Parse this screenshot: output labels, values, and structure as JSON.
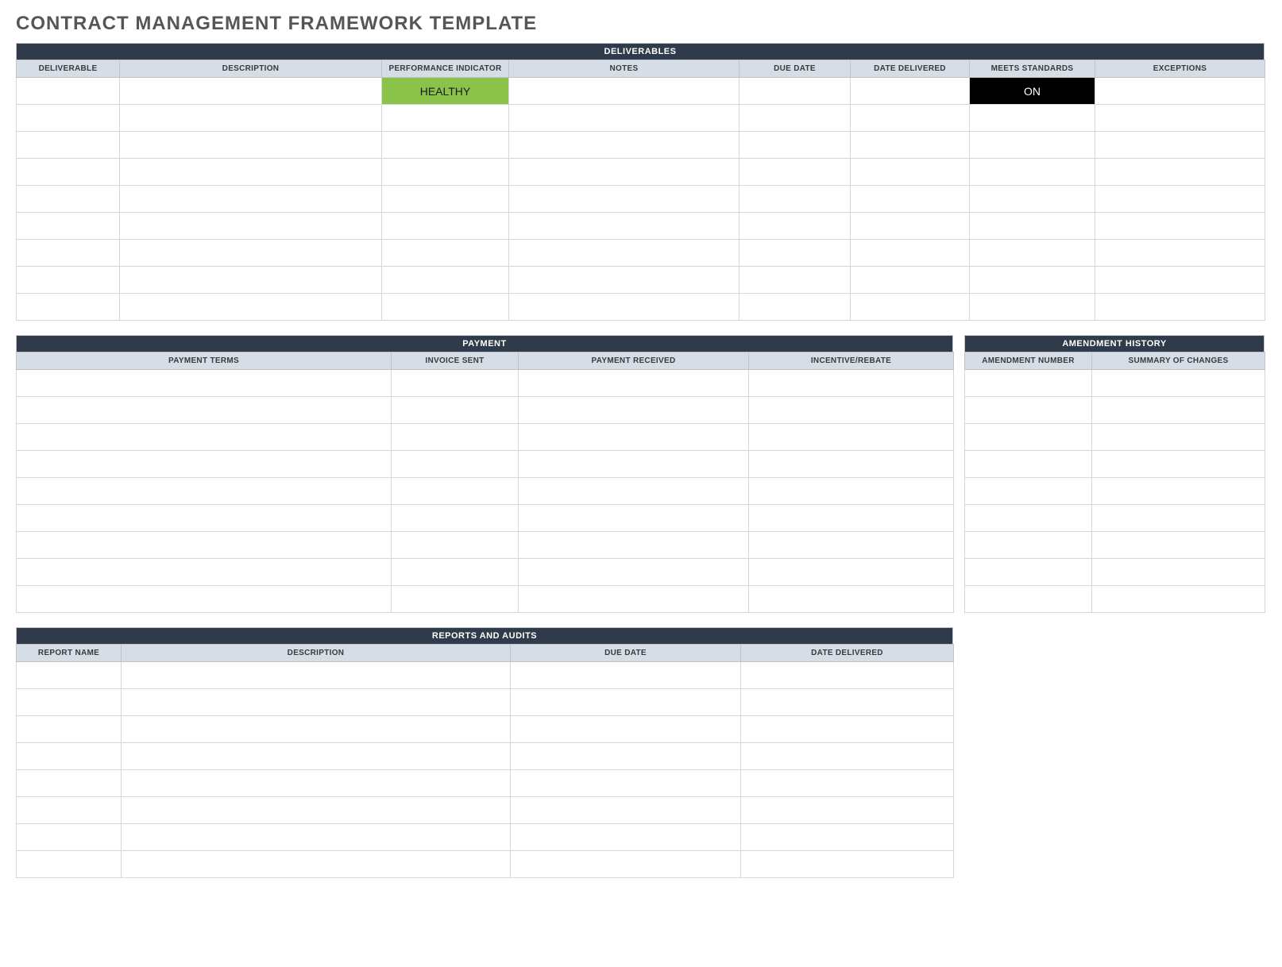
{
  "title": "CONTRACT MANAGEMENT FRAMEWORK TEMPLATE",
  "sections": {
    "deliverables": {
      "title": "DELIVERABLES",
      "columns": [
        "DELIVERABLE",
        "DESCRIPTION",
        "PERFORMANCE INDICATOR",
        "NOTES",
        "DUE DATE",
        "DATE DELIVERED",
        "MEETS STANDARDS",
        "EXCEPTIONS"
      ],
      "rows": [
        {
          "performance_indicator": "HEALTHY",
          "meets_standards": "ON"
        },
        {},
        {},
        {},
        {},
        {},
        {},
        {},
        {}
      ]
    },
    "payment": {
      "title": "PAYMENT",
      "columns": [
        "PAYMENT TERMS",
        "INVOICE SENT",
        "PAYMENT RECEIVED",
        "INCENTIVE/REBATE"
      ],
      "rows": [
        {},
        {},
        {},
        {},
        {},
        {},
        {},
        {},
        {}
      ]
    },
    "amendments": {
      "title": "AMENDMENT HISTORY",
      "columns": [
        "AMENDMENT NUMBER",
        "SUMMARY OF CHANGES"
      ],
      "rows": [
        {},
        {},
        {},
        {},
        {},
        {},
        {},
        {},
        {}
      ]
    },
    "reports": {
      "title": "REPORTS AND AUDITS",
      "columns": [
        "REPORT NAME",
        "DESCRIPTION",
        "DUE DATE",
        "DATE DELIVERED"
      ],
      "rows": [
        {},
        {},
        {},
        {},
        {},
        {},
        {},
        {}
      ]
    }
  }
}
